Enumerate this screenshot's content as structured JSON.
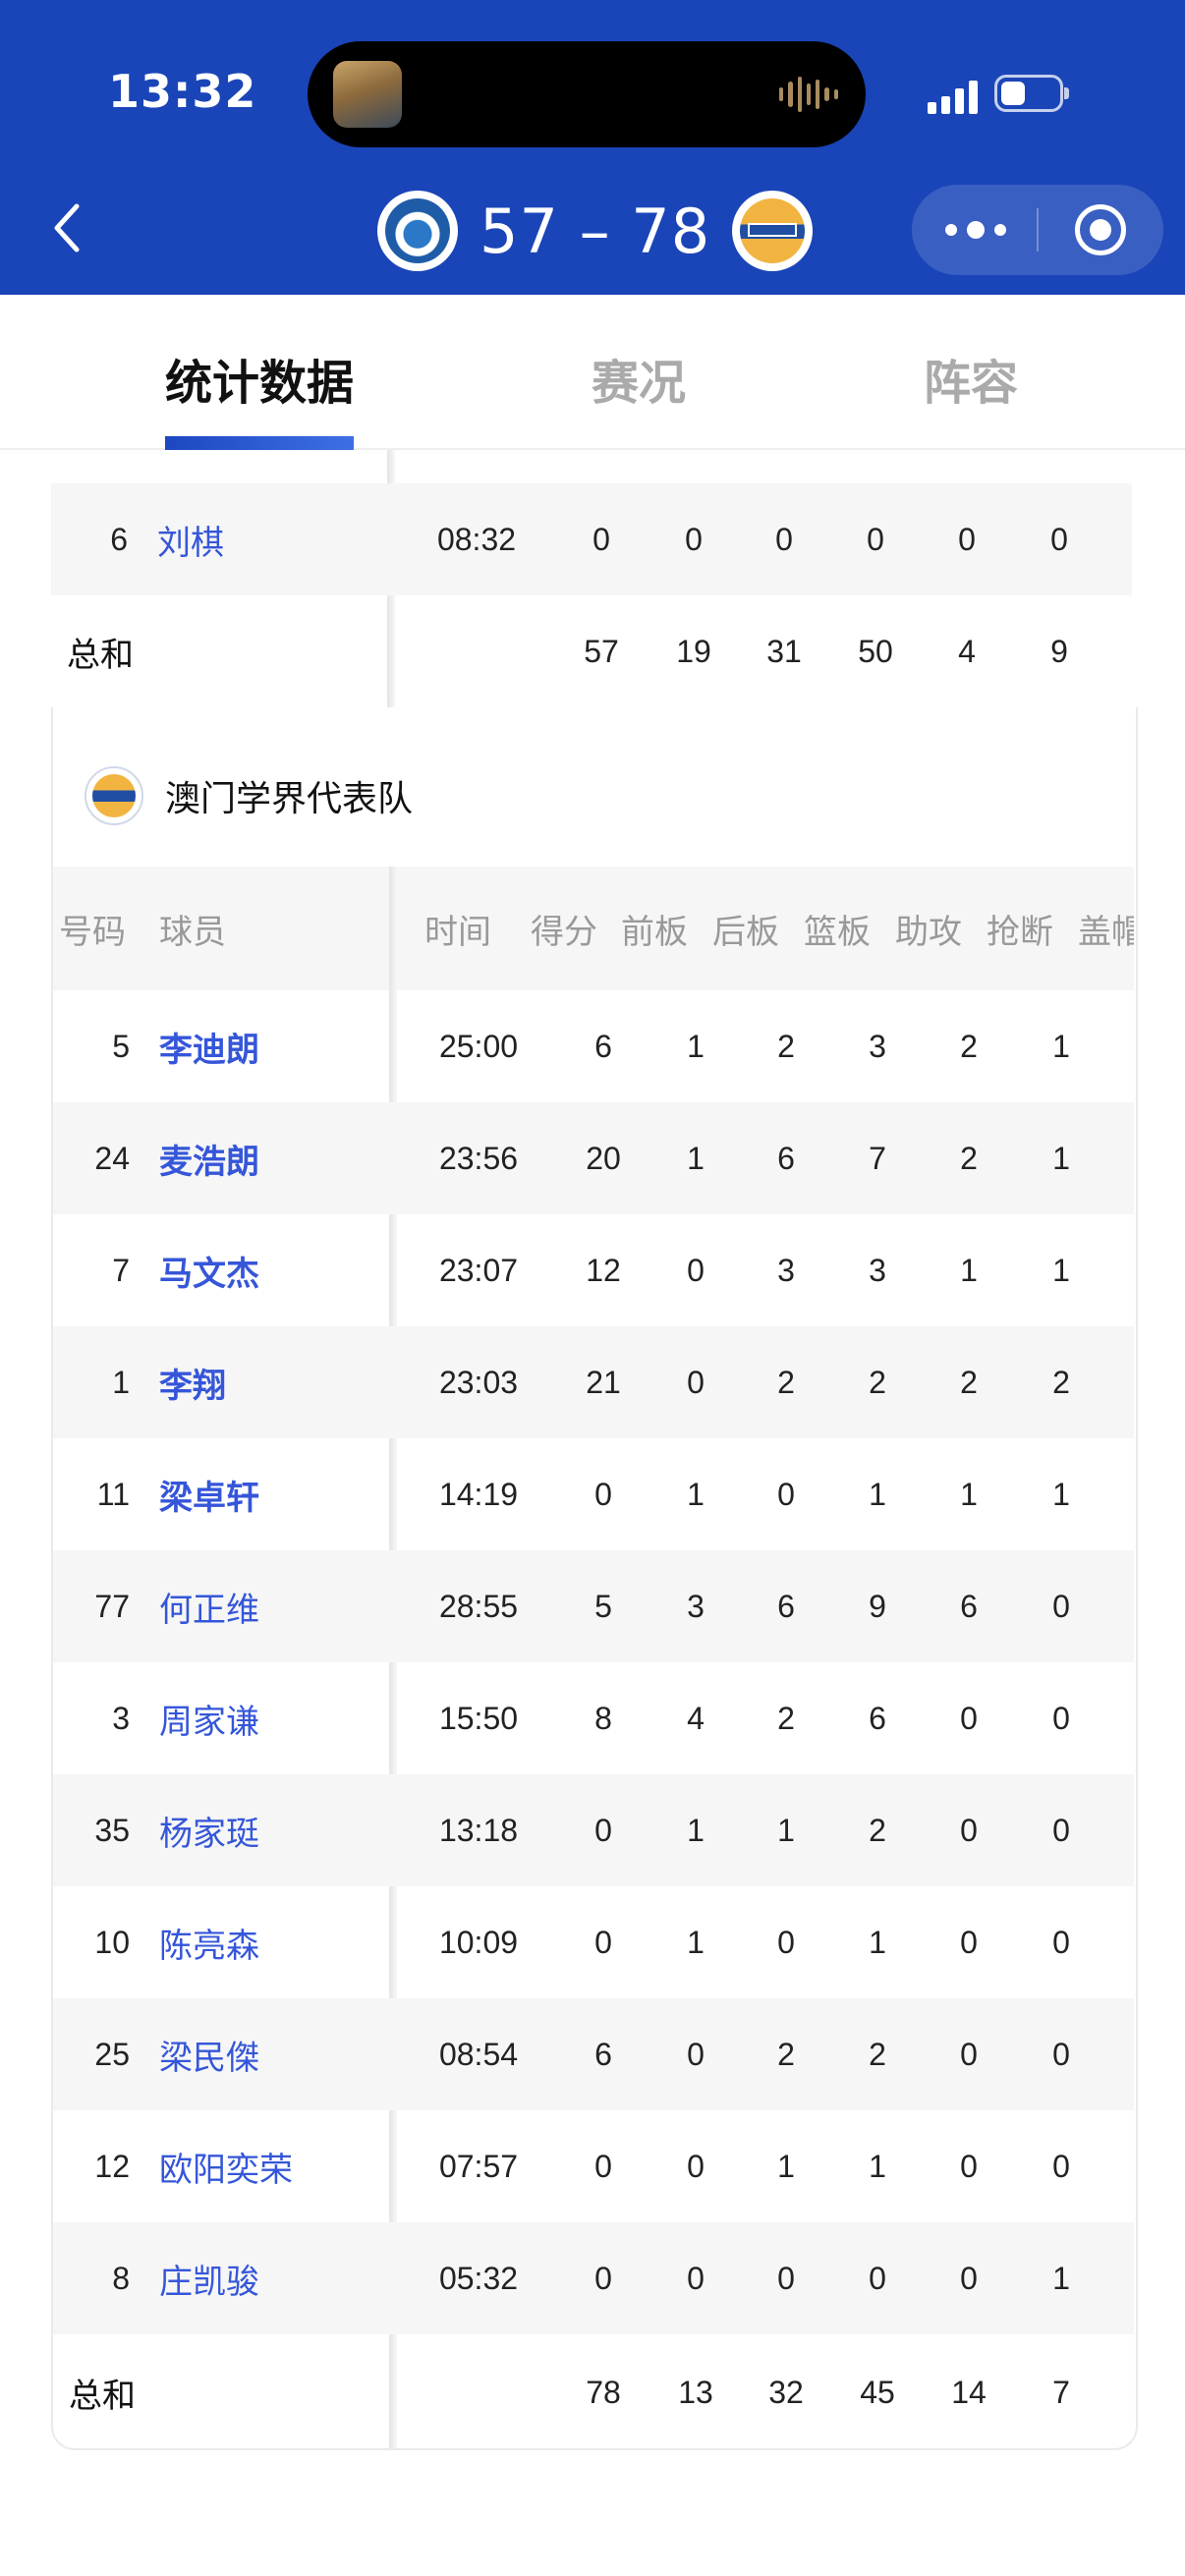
{
  "status_bar": {
    "time": "13:32"
  },
  "header": {
    "score": "57 – 78",
    "home_logo_icon": "team-badge-icon",
    "away_logo_icon": "macau-academic-team-badge-icon"
  },
  "tabs": [
    {
      "label": "统计数据",
      "active": true
    },
    {
      "label": "赛况",
      "active": false
    },
    {
      "label": "阵容",
      "active": false
    }
  ],
  "home_table": {
    "rows": [
      {
        "number": "6",
        "name": "刘棋",
        "time": "08:32",
        "pts": "0",
        "oreb": "0",
        "dreb": "0",
        "reb": "0",
        "ast": "0",
        "stl": "0"
      }
    ],
    "total": {
      "label": "总和",
      "pts": "57",
      "oreb": "19",
      "dreb": "31",
      "reb": "50",
      "ast": "4",
      "stl": "9"
    }
  },
  "away_table": {
    "team_name": "澳门学界代表队",
    "columns": [
      "号码",
      "球员",
      "时间",
      "得分",
      "前板",
      "后板",
      "篮板",
      "助攻",
      "抢断",
      "盖帽"
    ],
    "rows": [
      {
        "number": "5",
        "name": "李迪朗",
        "bold": true,
        "time": "25:00",
        "pts": "6",
        "oreb": "1",
        "dreb": "2",
        "reb": "3",
        "ast": "2",
        "stl": "1"
      },
      {
        "number": "24",
        "name": "麦浩朗",
        "bold": true,
        "time": "23:56",
        "pts": "20",
        "oreb": "1",
        "dreb": "6",
        "reb": "7",
        "ast": "2",
        "stl": "1"
      },
      {
        "number": "7",
        "name": "马文杰",
        "bold": true,
        "time": "23:07",
        "pts": "12",
        "oreb": "0",
        "dreb": "3",
        "reb": "3",
        "ast": "1",
        "stl": "1"
      },
      {
        "number": "1",
        "name": "李翔",
        "bold": true,
        "time": "23:03",
        "pts": "21",
        "oreb": "0",
        "dreb": "2",
        "reb": "2",
        "ast": "2",
        "stl": "2"
      },
      {
        "number": "11",
        "name": "梁卓轩",
        "bold": true,
        "time": "14:19",
        "pts": "0",
        "oreb": "1",
        "dreb": "0",
        "reb": "1",
        "ast": "1",
        "stl": "1"
      },
      {
        "number": "77",
        "name": "何正维",
        "bold": false,
        "time": "28:55",
        "pts": "5",
        "oreb": "3",
        "dreb": "6",
        "reb": "9",
        "ast": "6",
        "stl": "0"
      },
      {
        "number": "3",
        "name": "周家谦",
        "bold": false,
        "time": "15:50",
        "pts": "8",
        "oreb": "4",
        "dreb": "2",
        "reb": "6",
        "ast": "0",
        "stl": "0"
      },
      {
        "number": "35",
        "name": "杨家珽",
        "bold": false,
        "time": "13:18",
        "pts": "0",
        "oreb": "1",
        "dreb": "1",
        "reb": "2",
        "ast": "0",
        "stl": "0"
      },
      {
        "number": "10",
        "name": "陈亮森",
        "bold": false,
        "time": "10:09",
        "pts": "0",
        "oreb": "1",
        "dreb": "0",
        "reb": "1",
        "ast": "0",
        "stl": "0"
      },
      {
        "number": "25",
        "name": "梁民傑",
        "bold": false,
        "time": "08:54",
        "pts": "6",
        "oreb": "0",
        "dreb": "2",
        "reb": "2",
        "ast": "0",
        "stl": "0"
      },
      {
        "number": "12",
        "name": "欧阳奕荣",
        "bold": false,
        "time": "07:57",
        "pts": "0",
        "oreb": "0",
        "dreb": "1",
        "reb": "1",
        "ast": "0",
        "stl": "0"
      },
      {
        "number": "8",
        "name": "庄凯骏",
        "bold": false,
        "time": "05:32",
        "pts": "0",
        "oreb": "0",
        "dreb": "0",
        "reb": "0",
        "ast": "0",
        "stl": "1"
      }
    ],
    "total": {
      "label": "总和",
      "pts": "78",
      "oreb": "13",
      "dreb": "32",
      "reb": "45",
      "ast": "14",
      "stl": "7"
    }
  },
  "colors": {
    "header_bg": "#1a45b8",
    "player_link": "#3556d9",
    "row_alt": "#f6f6f6"
  }
}
